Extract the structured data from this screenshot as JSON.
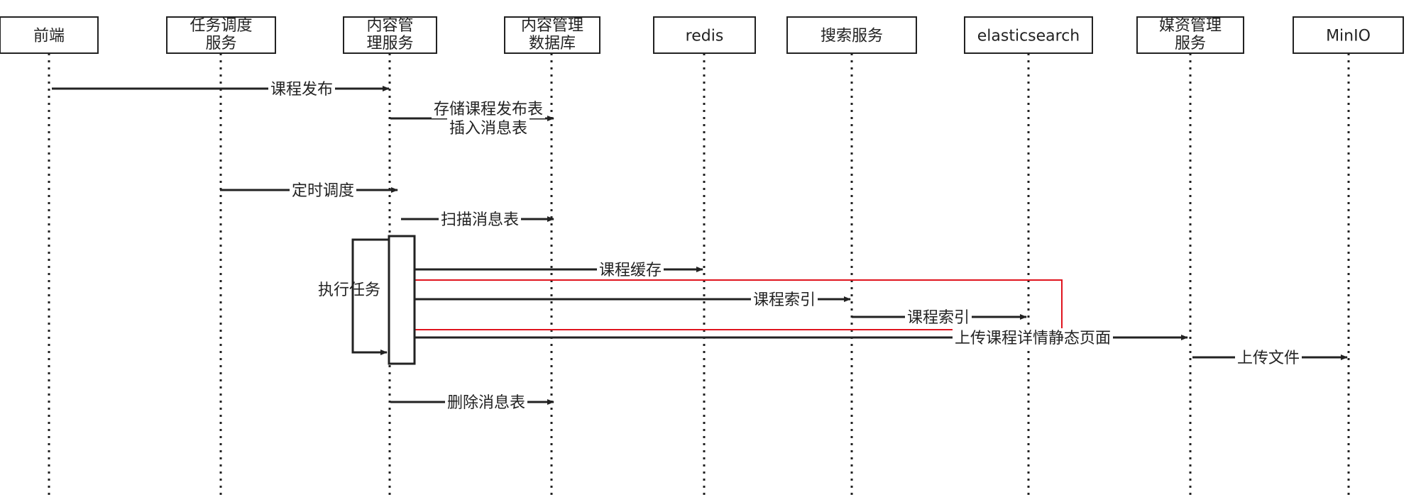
{
  "participants": [
    {
      "id": "p0",
      "label_lines": [
        "前端"
      ]
    },
    {
      "id": "p1",
      "label_lines": [
        "任务调度",
        "服务"
      ]
    },
    {
      "id": "p2",
      "label_lines": [
        "内容管",
        "理服务"
      ]
    },
    {
      "id": "p3",
      "label_lines": [
        "内容管理",
        "数据库"
      ]
    },
    {
      "id": "p4",
      "label_lines": [
        "redis"
      ]
    },
    {
      "id": "p5",
      "label_lines": [
        "搜索服务"
      ]
    },
    {
      "id": "p6",
      "label_lines": [
        "elasticsearch"
      ]
    },
    {
      "id": "p7",
      "label_lines": [
        "媒资管理",
        "服务"
      ]
    },
    {
      "id": "p8",
      "label_lines": [
        "MinIO"
      ]
    }
  ],
  "messages": [
    {
      "from": "p0",
      "to": "p2",
      "label_lines": [
        "课程发布"
      ]
    },
    {
      "from": "p2",
      "to": "p3",
      "label_lines": [
        "存储课程发布表",
        "插入消息表"
      ]
    },
    {
      "from": "p1",
      "to": "p2",
      "label_lines": [
        "定时调度"
      ]
    },
    {
      "from": "p2",
      "to": "p3",
      "label_lines": [
        "扫描消息表"
      ]
    },
    {
      "from": "p2",
      "to": "p4",
      "label_lines": [
        "课程缓存"
      ]
    },
    {
      "from": "p2",
      "to": "p5",
      "label_lines": [
        "课程索引"
      ]
    },
    {
      "from": "p5",
      "to": "p6",
      "label_lines": [
        "课程索引"
      ]
    },
    {
      "from": "p2",
      "to": "p7",
      "label_lines": [
        "上传课程详情静态页面"
      ]
    },
    {
      "from": "p7",
      "to": "p8",
      "label_lines": [
        "上传文件"
      ]
    },
    {
      "from": "p2",
      "to": "p3",
      "label_lines": [
        "删除消息表"
      ]
    }
  ],
  "self_call": {
    "on": "p2",
    "label": "执行任务"
  },
  "highlight": {
    "color": "#e0141e",
    "covers": "课程索引"
  }
}
